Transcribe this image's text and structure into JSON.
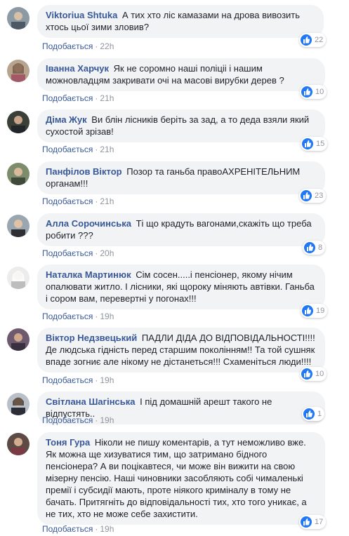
{
  "ui": {
    "like_label": "Подобається",
    "separator": "·"
  },
  "colors": {
    "author": "#385898",
    "bubble": "#f2f3f5",
    "like": "#2078f4",
    "muted": "#90949c"
  },
  "comments": [
    {
      "author": "Viktoriua Shtuka",
      "text": "А тих хто ліс камазами на дрова вивозить хтось цьої зими зловив?",
      "time": "22h",
      "likes": "22"
    },
    {
      "author": "Іванна Харчук",
      "text": "Як не соромно нашi полiцii i нашим можновладцям закривати очi на масовi вирубки дерев ?",
      "time": "21h",
      "likes": "10"
    },
    {
      "author": "Діма Жук",
      "text": "Ви блін лісників беріть за зад, а то деда взяли який сухостой зрізав!",
      "time": "21h",
      "likes": "15"
    },
    {
      "author": "Панфілов Віктор",
      "text": "Позор та ганьба правоАХРЕНІТЕЛЬНИМ органам!!!",
      "time": "21h",
      "likes": "23"
    },
    {
      "author": "Алла Сорочинська",
      "text": "Ті що крадуть вагонами,скажіть що треба робити ???",
      "time": "20h",
      "likes": "8"
    },
    {
      "author": "Наталка Мартинюк",
      "text": "Сім сосен.....і пенсіонер, якому нічим опалювати житло. І лісники, які щороку міняють автівки. Ганьба і сором вам, перевертні у погонах!!!",
      "time": "19h",
      "likes": "19"
    },
    {
      "author": "Віктор Недзвецький",
      "text": "ПАДЛИ ДІДА ДО ВІДПОВІДАЛЬНОСТІ!!!! Де людська гідність перед старшим поколінням!! Та той сушняк впаде зогниє але нікому не дістанеться!!! Схаменіться люди!!!!",
      "time": "19h",
      "likes": "10"
    },
    {
      "author": "Світлана Шагінська",
      "text": "І під домашній арешт такого не відпустять..",
      "time": "19h",
      "likes": "1"
    },
    {
      "author": "Тоня Гура",
      "text": "Ніколи не пишу коментарів, а тут неможливо вже. Як можна ще хизуватися тим, що затримано бідного пенсіонера? А ви поцікавтеся, чи може він вижити на свою мізерну пенсію. Наші чиновники засобляють собі чималенькі премії і субсидії мають, проте ніякого криміналу в тому не бачать. Притягніть до відповідальності тих, хто того уникає, а не тих, хто не може себе захистити.",
      "time": "19h",
      "likes": "17"
    }
  ]
}
